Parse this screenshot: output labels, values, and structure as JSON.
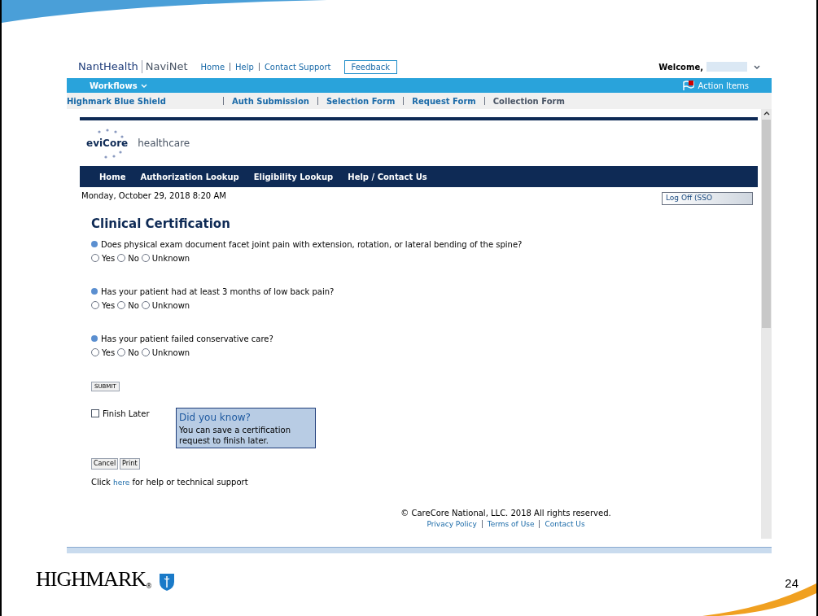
{
  "header": {
    "brand": "NantHealth",
    "product": "NaviNet",
    "links": [
      "Home",
      "Help",
      "Contact Support"
    ],
    "feedback": "Feedback",
    "welcome": "Welcome,"
  },
  "bluebar": {
    "workflows": "Workflows",
    "action_items": "Action Items"
  },
  "subnav": {
    "plan": "Highmark Blue Shield",
    "steps": [
      {
        "label": "Auth Submission",
        "selected": false
      },
      {
        "label": "Selection Form",
        "selected": false
      },
      {
        "label": "Request Form",
        "selected": false
      },
      {
        "label": "Collection Form",
        "selected": true
      }
    ]
  },
  "evicore": {
    "logo": "eviCore",
    "logo_suffix": "healthcare",
    "nav": [
      "Home",
      "Authorization Lookup",
      "Eligibility Lookup",
      "Help / Contact Us"
    ],
    "date": "Monday, October 29, 2018 8:20 AM",
    "logoff": "Log Off (SSO"
  },
  "form": {
    "title": "Clinical Certification",
    "questions": [
      {
        "text": "Does physical exam document facet joint pain with extension, rotation, or lateral bending of the spine?",
        "options": [
          {
            "label": "Yes",
            "selected": false
          },
          {
            "label": "No",
            "selected": false
          },
          {
            "label": "Unknown",
            "selected": false
          }
        ]
      },
      {
        "text": "Has your patient had at least 3 months of low back pain?",
        "options": [
          {
            "label": "Yes",
            "selected": false
          },
          {
            "label": "No",
            "selected": false
          },
          {
            "label": "Unknown",
            "selected": false
          }
        ]
      },
      {
        "text": "Has your patient failed conservative care?",
        "options": [
          {
            "label": "Yes",
            "selected": false
          },
          {
            "label": "No",
            "selected": false
          },
          {
            "label": "Unknown",
            "selected": false
          }
        ]
      }
    ],
    "submit": "SUBMIT",
    "finish_later": {
      "label": "Finish Later",
      "checked": false
    },
    "tip": {
      "title": "Did you know?",
      "body": "You can save a certification request to finish later."
    },
    "buttons": [
      "Cancel",
      "Print"
    ],
    "help": {
      "before": "Click",
      "link": "here",
      "after": "for help or technical support"
    }
  },
  "footer": {
    "copyright": "© CareCore National, LLC. 2018 All rights reserved.",
    "links": [
      "Privacy Policy",
      "Terms of Use",
      "Contact Us"
    ]
  },
  "slide": {
    "logo": "HIGHMARK",
    "registered": "®",
    "page_number": "24"
  }
}
